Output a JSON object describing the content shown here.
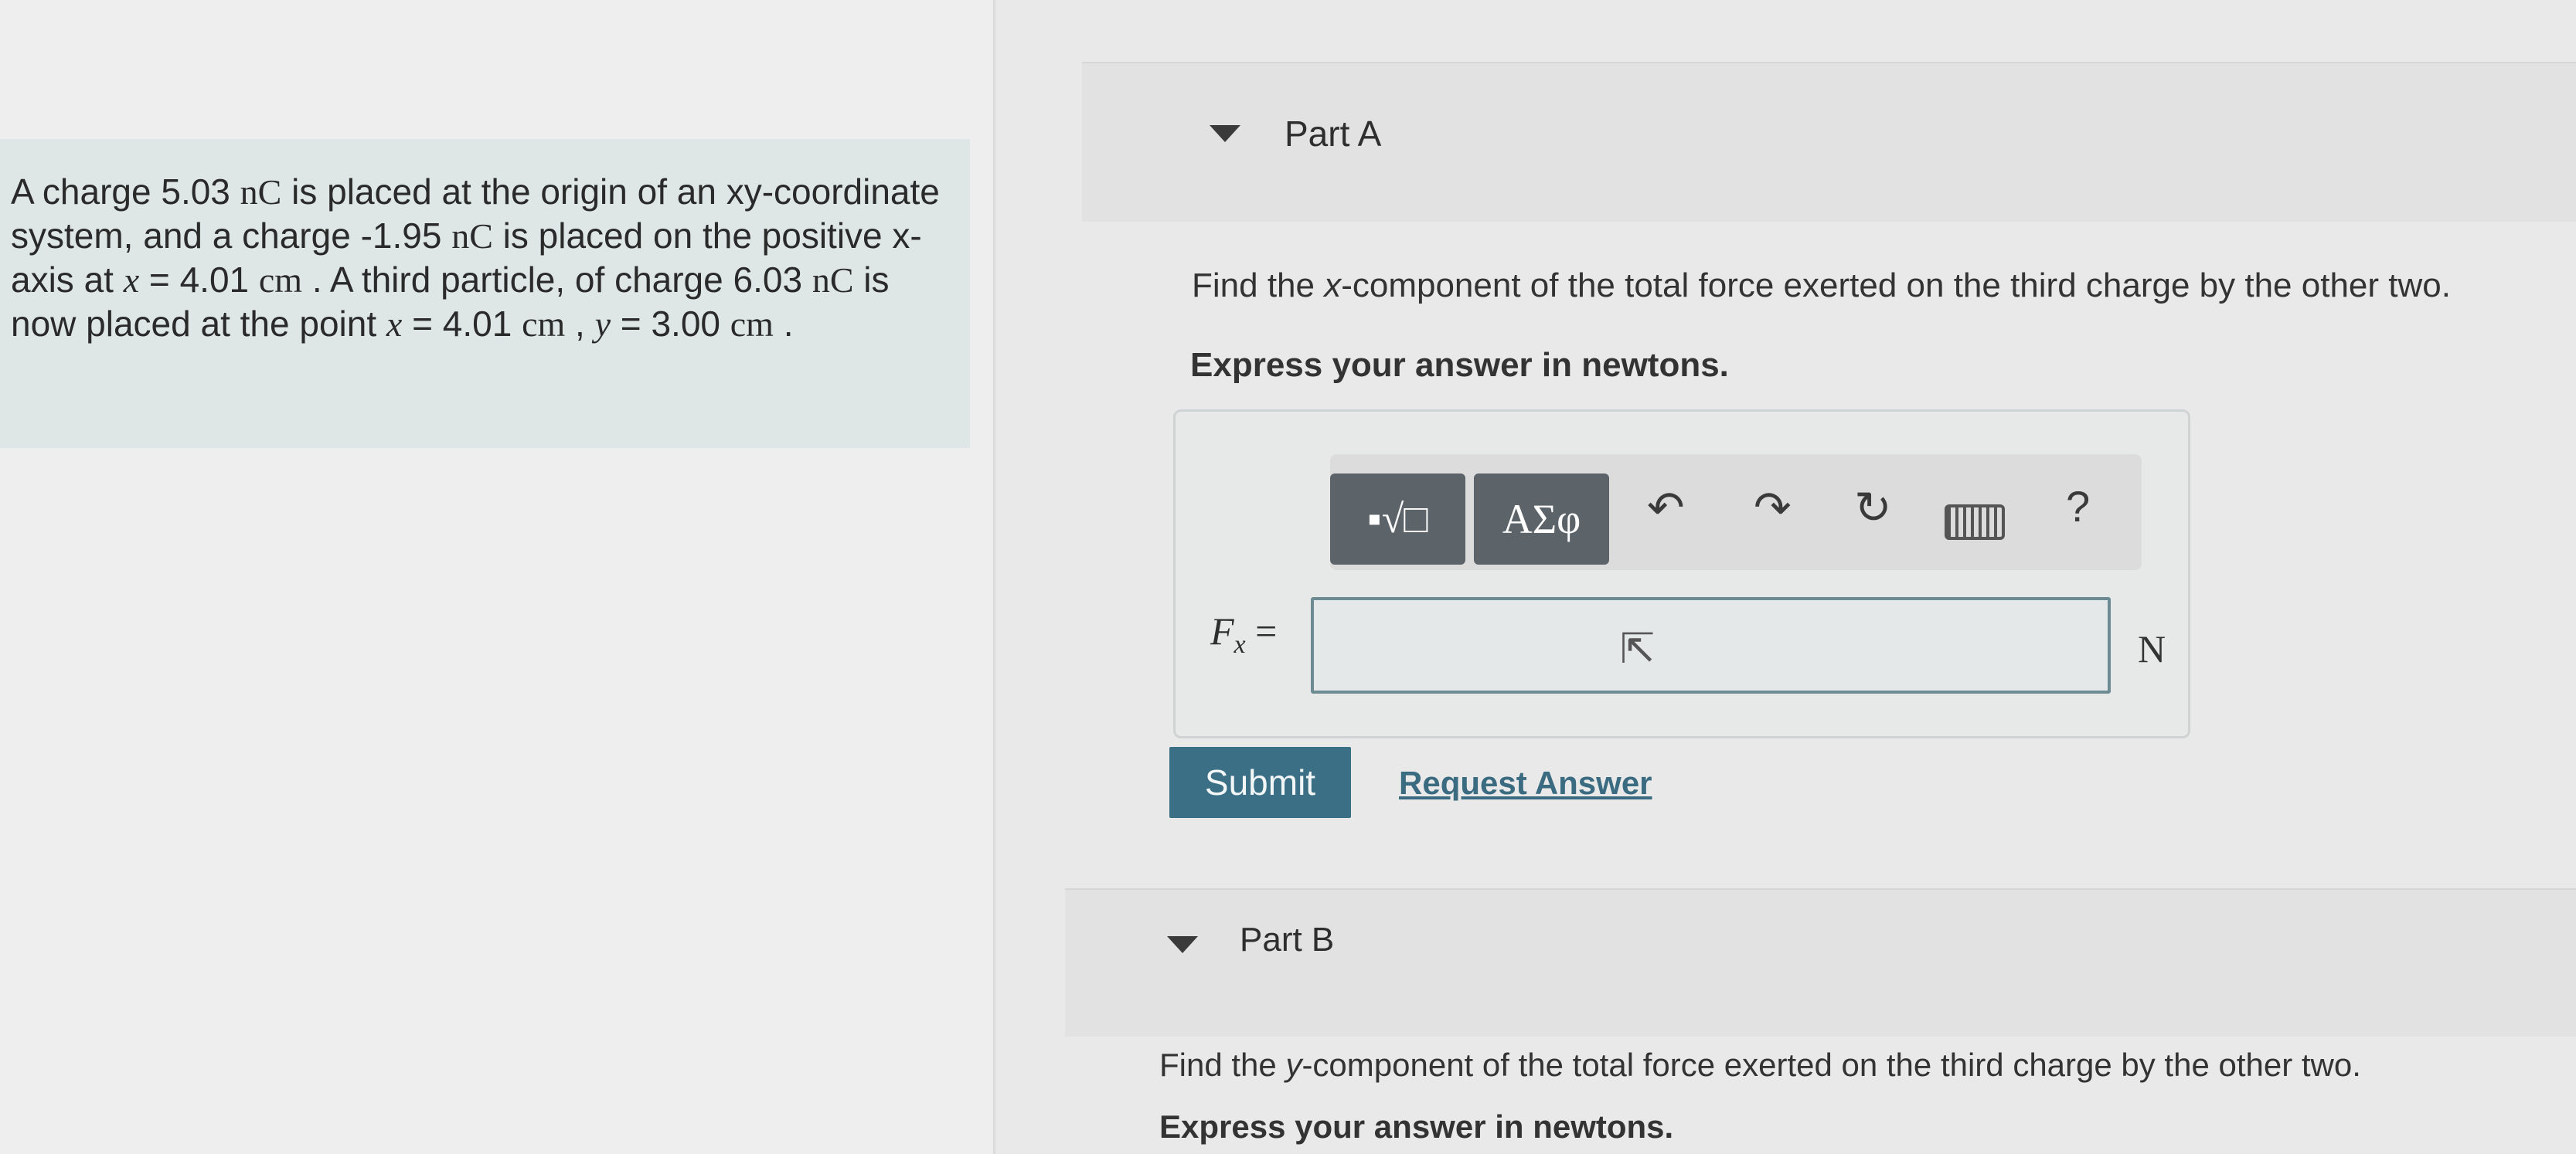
{
  "problem": {
    "text1": "A charge 5.03 ",
    "unit_nC_1": "nC",
    "text2": " is placed at the origin of an xy-coordinate system, and a charge -1.95 ",
    "unit_nC_2": "nC",
    "text3": " is placed on the positive x-axis at ",
    "x_var_1": "x",
    "text4": " = 4.01 ",
    "unit_cm_1": "cm",
    "text5": " . A third particle, of charge 6.03 ",
    "unit_nC_3": "nC",
    "text6": " is now placed at the point ",
    "x_var_2": "x",
    "text7": " = 4.01 ",
    "unit_cm_2": "cm",
    "text8": " , ",
    "y_var": "y",
    "text9": " = 3.00 ",
    "unit_cm_3": "cm",
    "text10": " ."
  },
  "part_a": {
    "title": "Part A",
    "prompt_start": "Find the ",
    "prompt_component": "x",
    "prompt_end": "-component of the total force exerted on the third charge by the other two.",
    "instruction": "Express your answer in newtons.",
    "toolbar": {
      "templates_label": "▪√□",
      "greek_label": "ΑΣφ",
      "help_label": "?"
    },
    "answer_label_var": "F",
    "answer_label_sub": "x",
    "answer_label_eq": " =",
    "answer_value": "",
    "unit": "N",
    "submit_label": "Submit",
    "request_label": "Request Answer"
  },
  "part_b": {
    "title": "Part B",
    "prompt_start": "Find the ",
    "prompt_component": "y",
    "prompt_end": "-component of the total force exerted on the third charge by the other two.",
    "instruction": "Express your answer in newtons."
  },
  "colors": {
    "submit_bg": "#3b6f86",
    "link": "#3a6b80",
    "toolbar_btn": "#5d6469",
    "problem_bg": "#dfe7e6"
  }
}
